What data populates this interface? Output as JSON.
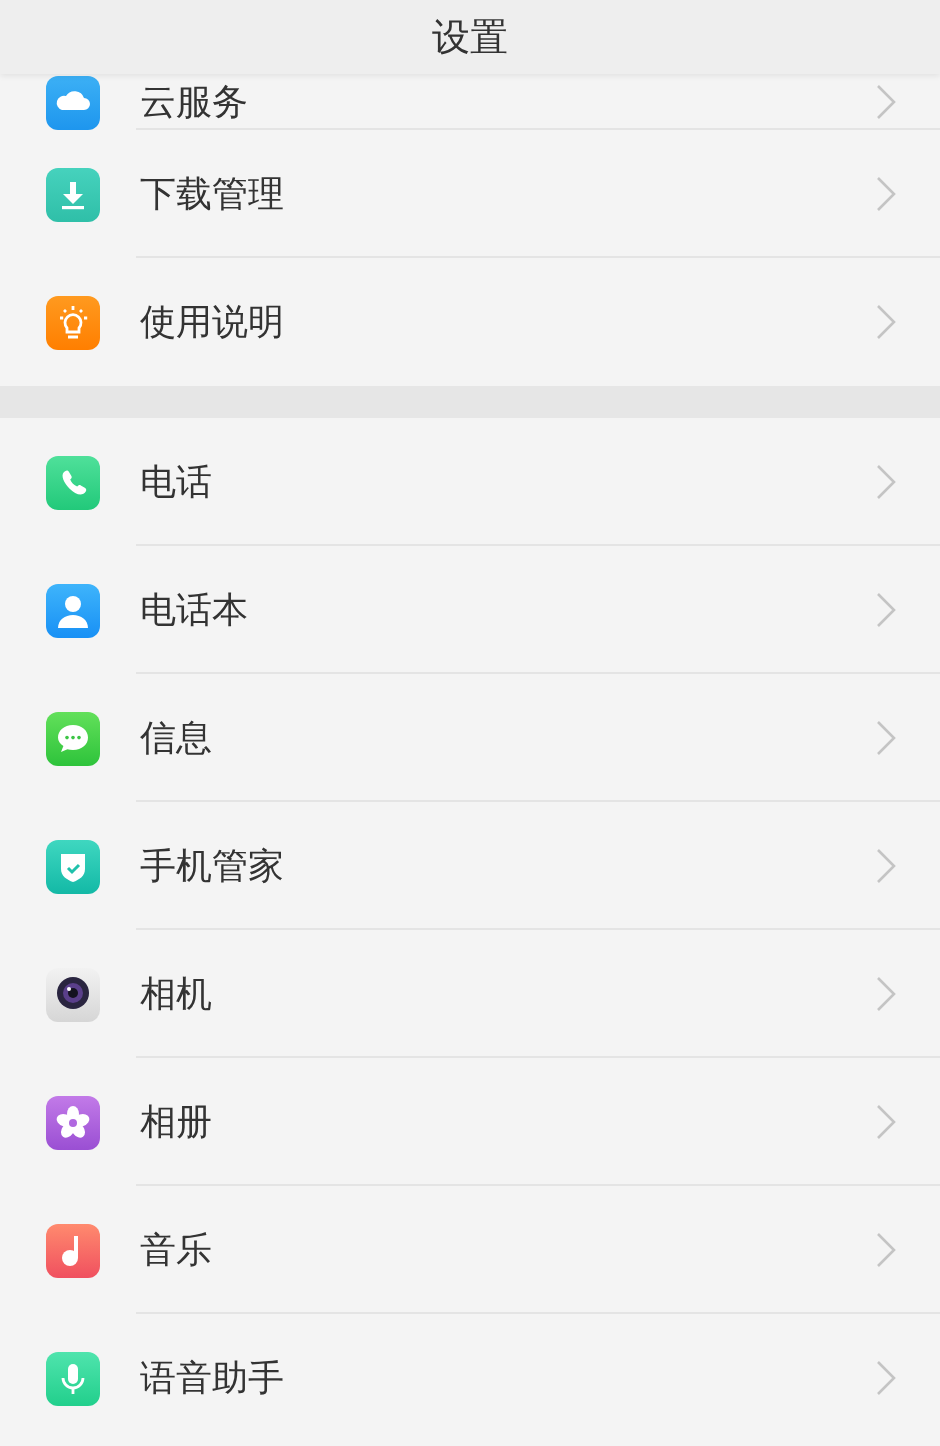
{
  "header": {
    "title": "设置"
  },
  "sections": [
    {
      "items": [
        {
          "label": "云服务",
          "kind": "cloud"
        },
        {
          "label": "下载管理",
          "kind": "download"
        },
        {
          "label": "使用说明",
          "kind": "bulb"
        }
      ]
    },
    {
      "items": [
        {
          "label": "电话",
          "kind": "phone"
        },
        {
          "label": "电话本",
          "kind": "contact"
        },
        {
          "label": "信息",
          "kind": "message"
        },
        {
          "label": "手机管家",
          "kind": "shield"
        },
        {
          "label": "相机",
          "kind": "camera"
        },
        {
          "label": "相册",
          "kind": "flower"
        },
        {
          "label": "音乐",
          "kind": "music"
        },
        {
          "label": "语音助手",
          "kind": "mic"
        }
      ]
    }
  ]
}
